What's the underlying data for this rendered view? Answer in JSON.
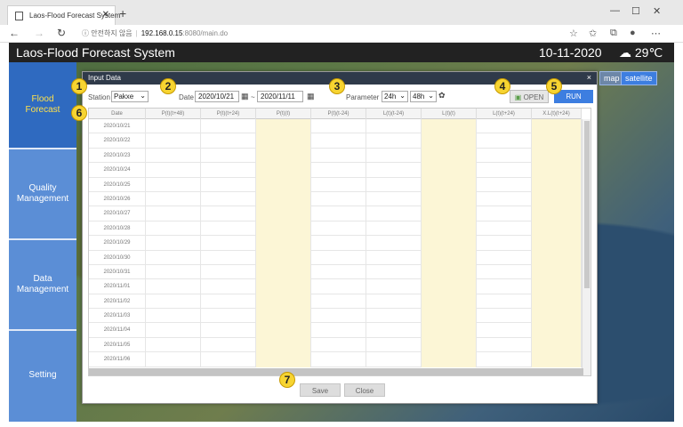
{
  "browser": {
    "tab_title": "Laos-Flood Forecast System",
    "url_warning": "ⓘ 안전하지 않음",
    "url_host": "192.168.0.15",
    "url_path": ":8080/main.do"
  },
  "header": {
    "title": "Laos-Flood Forecast System",
    "date": "10-11-2020",
    "temperature": "29℃"
  },
  "map_controls": {
    "map": "map",
    "satellite": "satellite"
  },
  "sidenav": {
    "items": [
      {
        "label1": "Flood",
        "label2": "Forecast"
      },
      {
        "label1": "Quality",
        "label2": "Management"
      },
      {
        "label1": "Data",
        "label2": "Management"
      },
      {
        "label1": "Setting",
        "label2": ""
      }
    ]
  },
  "dialog": {
    "title": "Input Data",
    "close": "×",
    "station_label": "Station",
    "station_value": "Pakxe",
    "date_label": "Date",
    "date_from": "2020/10/21",
    "date_sep": "~",
    "date_to": "2020/11/11",
    "parameter_label": "Parameter",
    "param1": "24h",
    "param2": "48h",
    "open_label": "OPEN",
    "run_label": "RUN",
    "save_label": "Save",
    "close_label": "Close"
  },
  "grid": {
    "columns": [
      "Date",
      "P(t)(t+48)",
      "P(t)(t+24)",
      "P(t)(t)",
      "P(t)(t-24)",
      "L(t)(t-24)",
      "L(t)(t)",
      "L(t)(t+24)",
      "X.L(t)(t+24)"
    ],
    "highlight_columns": [
      3,
      6,
      8
    ],
    "rows": [
      "2020/10/21",
      "2020/10/22",
      "2020/10/23",
      "2020/10/24",
      "2020/10/25",
      "2020/10/26",
      "2020/10/27",
      "2020/10/28",
      "2020/10/29",
      "2020/10/30",
      "2020/10/31",
      "2020/11/01",
      "2020/11/02",
      "2020/11/03",
      "2020/11/04",
      "2020/11/05",
      "2020/11/06"
    ]
  },
  "badges": [
    "1",
    "2",
    "3",
    "4",
    "5",
    "6",
    "7"
  ],
  "colors": {
    "run": "#3d7ee0",
    "nav": "#5b8ed6",
    "nav_active": "#2f6ac0",
    "badge": "#f7d431"
  }
}
